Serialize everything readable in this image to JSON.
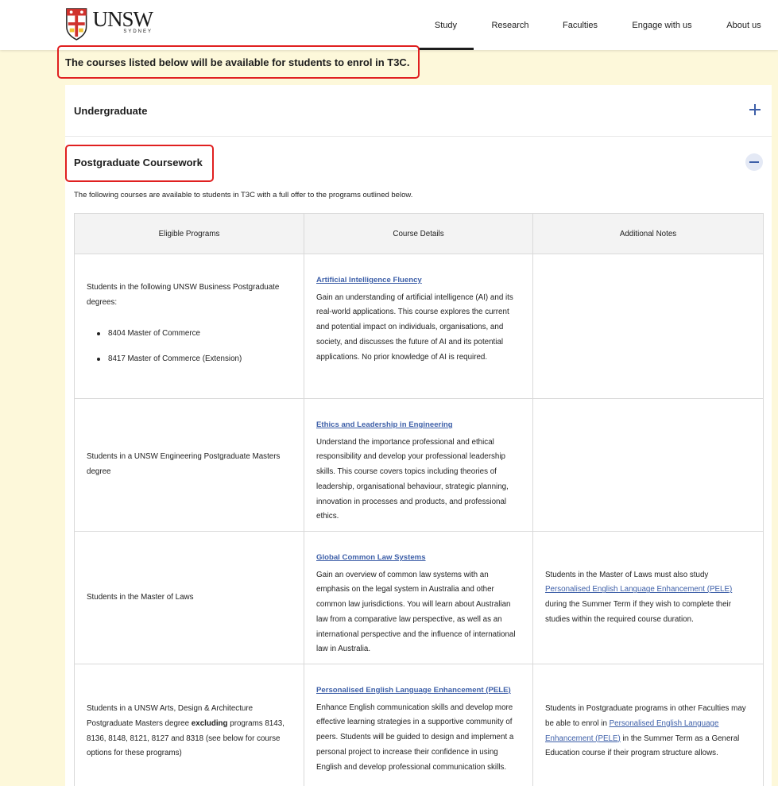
{
  "header": {
    "logo": {
      "name": "UNSW",
      "sub": "SYDNEY"
    },
    "nav": [
      {
        "label": "Study",
        "active": true
      },
      {
        "label": "Research",
        "active": false
      },
      {
        "label": "Faculties",
        "active": false
      },
      {
        "label": "Engage with us",
        "active": false
      },
      {
        "label": "About us",
        "active": false
      }
    ]
  },
  "notice": "The courses listed below will be available for students to enrol in T3C.",
  "accordion": [
    {
      "title": "Undergraduate",
      "expanded": false,
      "icon": "plus-icon"
    },
    {
      "title": "Postgraduate Coursework",
      "expanded": true,
      "icon": "minus-icon"
    }
  ],
  "intro": "The following courses are available to students in T3C with a full offer to the programs outlined below.",
  "table": {
    "headers": [
      "Eligible Programs",
      "Course Details",
      "Additional Notes"
    ],
    "rows": [
      {
        "programs": {
          "text": "Students in the following UNSW Business Postgraduate degrees:",
          "list": [
            "8404 Master of Commerce",
            "8417 Master of Commerce (Extension)"
          ]
        },
        "course": {
          "title": "Artificial Intelligence Fluency",
          "desc": "Gain an understanding of artificial intelligence (AI) and its real-world applications. This course explores the current and potential impact on individuals, organisations, and society, and discusses the future of AI and its potential applications. No prior knowledge of AI is required."
        },
        "notes": {}
      },
      {
        "programs": {
          "text": "Students in a UNSW Engineering Postgraduate Masters degree"
        },
        "course": {
          "title": "Ethics and Leadership in Engineering",
          "desc": "Understand the importance professional and ethical responsibility and develop your professional leadership skills. This course covers topics including theories of leadership, organisational behaviour, strategic planning, innovation in processes and products, and professional ethics."
        },
        "notes": {}
      },
      {
        "programs": {
          "text": "Students in the Master of Laws"
        },
        "course": {
          "title": "Global Common Law Systems",
          "desc": "Gain an overview of common law systems with an emphasis on the legal system in Australia and other common law jurisdictions. You will learn about Australian law from a comparative law perspective, as well as an international perspective and the influence of international law in Australia."
        },
        "notes": {
          "before": "Students in the Master of Laws must also study ",
          "link": "Personalised English Language Enhancement (PELE)",
          "after": " during the Summer Term if they wish to complete their studies within the required course duration."
        }
      },
      {
        "programs": {
          "before": "Students in a UNSW Arts, Design & Architecture Postgraduate Masters degree ",
          "bold": "excluding",
          "after": " programs 8143, 8136, 8148, 8121, 8127 and 8318 (see below for course options for these programs)"
        },
        "course": {
          "title": "Personalised English Language Enhancement (PELE)",
          "desc": "Enhance English communication skills and develop more effective learning strategies in a supportive community of peers. Students will be guided to design and implement a personal project to increase their confidence in using English and develop professional communication skills."
        },
        "notes": {
          "before": "Students in Postgraduate programs in other Faculties may be able to enrol in ",
          "link": "Personalised English Language Enhancement (PELE)",
          "after": " in the Summer Term as a General Education course if their program structure allows."
        }
      }
    ]
  },
  "colors": {
    "accent": "#3d5fa8",
    "highlight": "#e02020",
    "page_bg": "#fdf8da"
  }
}
